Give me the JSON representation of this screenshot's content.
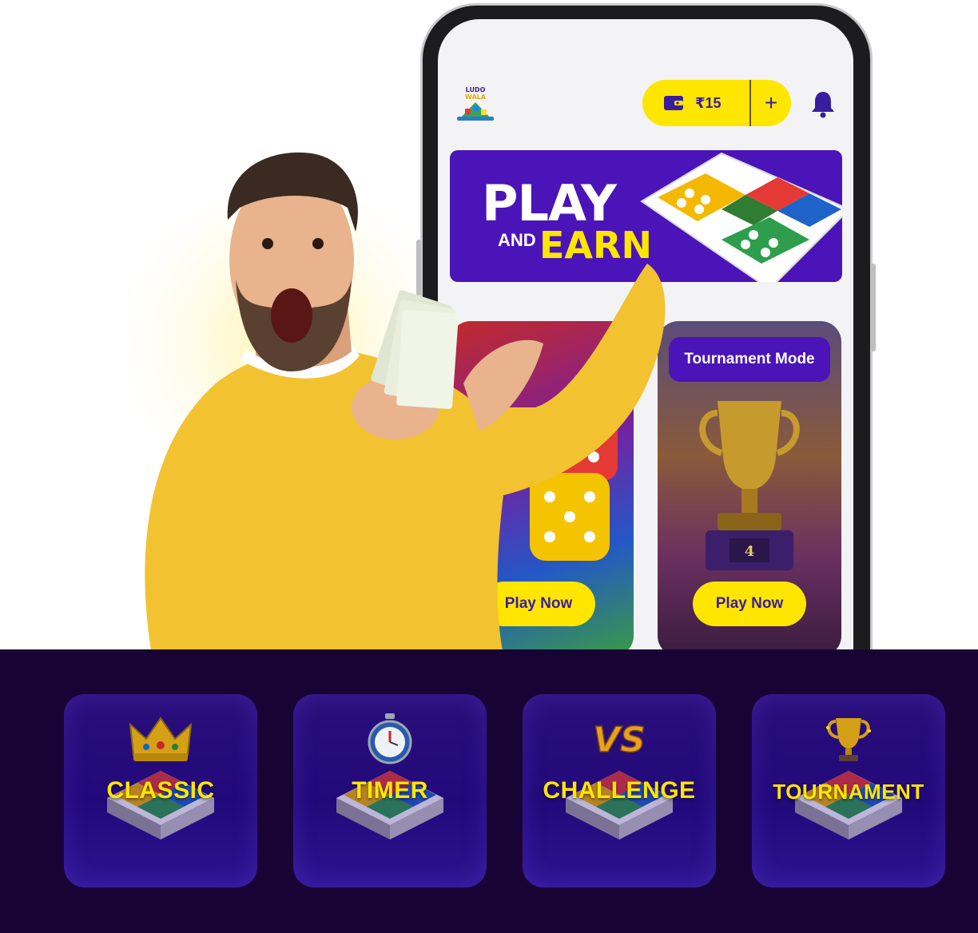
{
  "app": {
    "logo_text": "LUDO WALA",
    "wallet_amount": "₹15",
    "wallet_add": "+",
    "icons": {
      "wallet": "wallet-icon",
      "bell": "bell-icon"
    }
  },
  "banner": {
    "line1": "PLAY",
    "line2_small": "AND",
    "line2": "EARN"
  },
  "cards": [
    {
      "label": "",
      "play_label": "Play Now"
    },
    {
      "label": "Tournament Mode",
      "play_label": "Play Now"
    }
  ],
  "modes": [
    {
      "label": "CLASSIC",
      "icon": "crown-icon"
    },
    {
      "label": "TIMER",
      "icon": "stopwatch-icon"
    },
    {
      "label": "CHALLENGE",
      "icon": "vs-icon"
    },
    {
      "label": "TOURNAMENT",
      "icon": "trophy-icon"
    }
  ],
  "colors": {
    "accent_yellow": "#ffe600",
    "brand_purple": "#4a14b8",
    "dark_bg": "#180434",
    "mode_card": "#22097a"
  }
}
